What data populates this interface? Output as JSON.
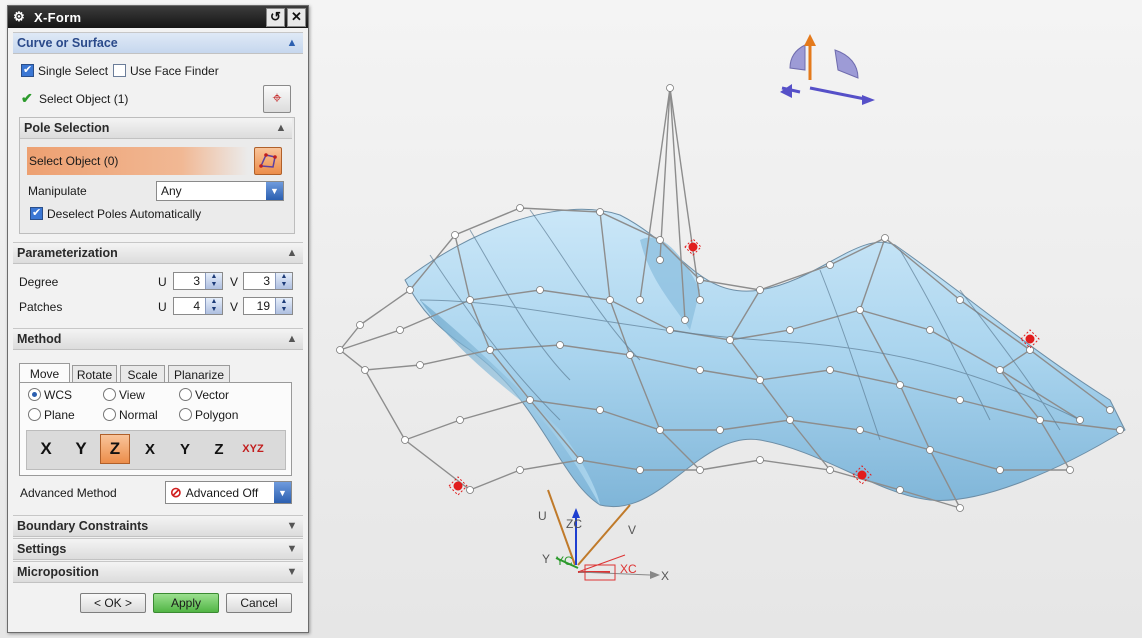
{
  "dialog": {
    "title": "X-Form",
    "reset_glyph": "↺",
    "close_glyph": "✕",
    "gear_glyph": "⚙"
  },
  "curve_or_surface": {
    "header": "Curve or Surface",
    "single_select": "Single Select",
    "use_face_finder": "Use Face Finder",
    "select_object": "Select Object (1)",
    "pole_selection": {
      "header": "Pole Selection",
      "select_object": "Select Object (0)",
      "manipulate_label": "Manipulate",
      "manipulate_value": "Any",
      "deselect_label": "Deselect Poles Automatically"
    }
  },
  "parameterization": {
    "header": "Parameterization",
    "degree_label": "Degree",
    "patches_label": "Patches",
    "u_label": "U",
    "v_label": "V",
    "degree_u": "3",
    "degree_v": "3",
    "patches_u": "4",
    "patches_v": "19"
  },
  "method": {
    "header": "Method",
    "tabs": [
      "Move",
      "Rotate",
      "Scale",
      "Planarize"
    ],
    "radios": {
      "wcs": "WCS",
      "view": "View",
      "vector": "Vector",
      "plane": "Plane",
      "normal": "Normal",
      "polygon": "Polygon"
    },
    "axis_buttons": [
      "X",
      "Y",
      "Z",
      "X",
      "Y",
      "Z",
      "XYZ"
    ],
    "advanced_label": "Advanced Method",
    "advanced_value": "Advanced Off"
  },
  "collapsed_sections": {
    "boundary": "Boundary Constraints",
    "settings": "Settings",
    "microposition": "Microposition"
  },
  "buttons": {
    "ok": "< OK >",
    "apply": "Apply",
    "cancel": "Cancel"
  },
  "viewport": {
    "labels": {
      "u": "U",
      "v": "V",
      "zc": "ZC",
      "yc": "YC",
      "y": "Y",
      "xc": "XC",
      "x": "X"
    },
    "colors": {
      "surface": "#a9d4ee",
      "surface_dark": "#6aa4c8",
      "pole": "#ffffff",
      "highlight": "#e11d1d"
    }
  }
}
